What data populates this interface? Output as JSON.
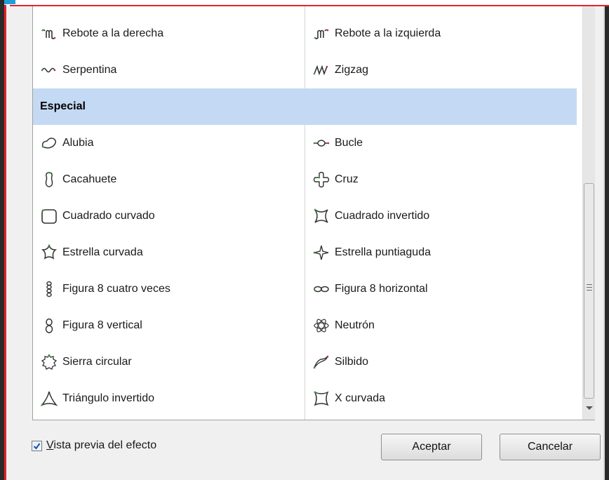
{
  "dialog": {
    "list": {
      "rows_top": [
        {
          "left": {
            "label": "Rebote a la derecha",
            "icon": "bounce-right-icon"
          },
          "right": {
            "label": "Rebote a la izquierda",
            "icon": "bounce-left-icon"
          }
        },
        {
          "left": {
            "label": "Serpentina",
            "icon": "serpentine-icon"
          },
          "right": {
            "label": "Zigzag",
            "icon": "zigzag-icon"
          }
        }
      ],
      "section": {
        "title": "Especial"
      },
      "rows_special": [
        {
          "left": {
            "label": "Alubia",
            "icon": "bean-icon"
          },
          "right": {
            "label": "Bucle",
            "icon": "loop-icon"
          }
        },
        {
          "left": {
            "label": "Cacahuete",
            "icon": "peanut-icon"
          },
          "right": {
            "label": "Cruz",
            "icon": "cross-icon"
          }
        },
        {
          "left": {
            "label": "Cuadrado curvado",
            "icon": "curved-square-icon"
          },
          "right": {
            "label": "Cuadrado invertido",
            "icon": "inverted-square-icon"
          }
        },
        {
          "left": {
            "label": "Estrella curvada",
            "icon": "curved-star-icon"
          },
          "right": {
            "label": "Estrella puntiaguda",
            "icon": "pointed-star-icon"
          }
        },
        {
          "left": {
            "label": "Figura 8 cuatro veces",
            "icon": "figure-8-four-icon"
          },
          "right": {
            "label": "Figura 8 horizontal",
            "icon": "figure-8-horizontal-icon"
          }
        },
        {
          "left": {
            "label": "Figura 8 vertical",
            "icon": "figure-8-vertical-icon"
          },
          "right": {
            "label": "Neutrón",
            "icon": "neutron-icon"
          }
        },
        {
          "left": {
            "label": "Sierra circular",
            "icon": "circular-saw-icon"
          },
          "right": {
            "label": "Silbido",
            "icon": "whistle-icon"
          }
        },
        {
          "left": {
            "label": "Triángulo invertido",
            "icon": "inverted-triangle-icon"
          },
          "right": {
            "label": "X curvada",
            "icon": "curved-x-icon"
          }
        }
      ]
    },
    "preview_checkbox": {
      "label_accel": "V",
      "label_rest": "ista previa del efecto",
      "checked": true
    },
    "buttons": {
      "ok": "Aceptar",
      "cancel": "Cancelar"
    }
  },
  "colors": {
    "selection": "#c4d9f3",
    "accent_red": "#e0262b",
    "accent_blue": "#1f9fd9"
  }
}
